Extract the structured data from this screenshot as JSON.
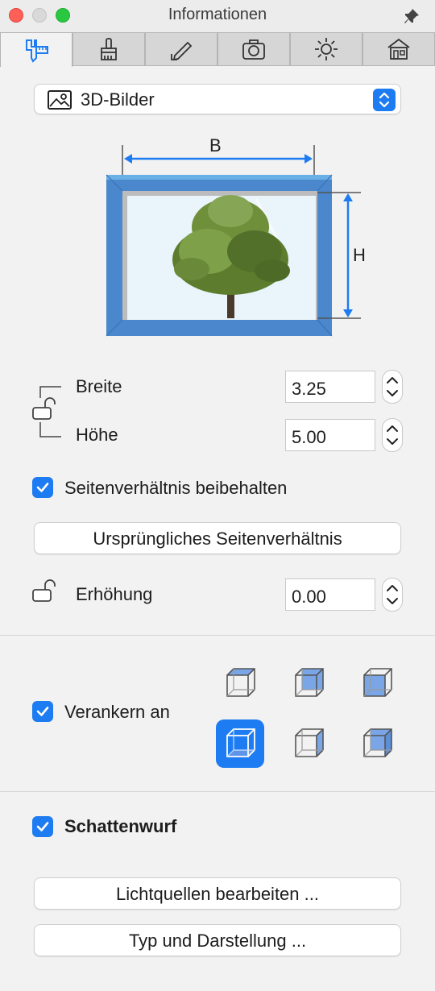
{
  "window": {
    "title": "Informationen"
  },
  "tabs": [
    {
      "icon": "caliper-ruler-icon",
      "active": true
    },
    {
      "icon": "brush-icon",
      "active": false
    },
    {
      "icon": "pencil-icon",
      "active": false
    },
    {
      "icon": "camera-icon",
      "active": false
    },
    {
      "icon": "sun-icon",
      "active": false
    },
    {
      "icon": "house-icon",
      "active": false
    }
  ],
  "object_type": {
    "selected": "3D-Bilder",
    "icon": "image-icon"
  },
  "diagram": {
    "width_label": "B",
    "height_label": "H"
  },
  "size": {
    "width_label": "Breite",
    "width_value": "3.25",
    "height_label": "Höhe",
    "height_value": "5.00"
  },
  "keep_ratio": {
    "label": "Seitenverhältnis beibehalten",
    "checked": true
  },
  "original_ratio_button": "Ursprüngliches Seitenverhältnis",
  "elevation": {
    "label": "Erhöhung",
    "value": "0.00"
  },
  "anchor": {
    "label": "Verankern an",
    "checked": true,
    "selected_index": 3
  },
  "shadow": {
    "label": "Schattenwurf",
    "checked": true
  },
  "buttons": {
    "edit_lights": "Lichtquellen bearbeiten ...",
    "type_display": "Typ und Darstellung ..."
  },
  "colors": {
    "accent": "#1d7cf2",
    "frame": "#4a87cc"
  }
}
